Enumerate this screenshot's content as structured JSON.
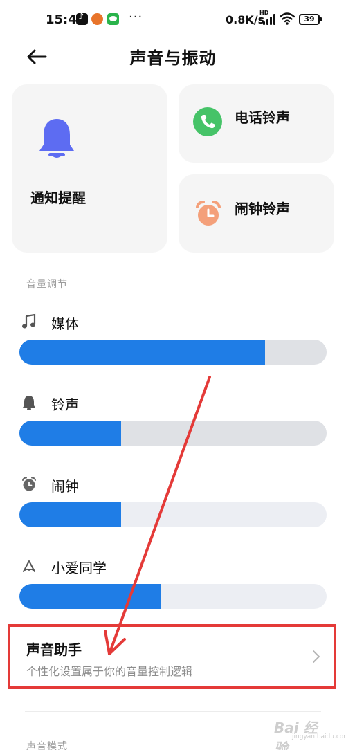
{
  "status_bar": {
    "time": "15:41",
    "dots": "···",
    "network_speed": "0.8K/s",
    "hd_label": "HD",
    "battery": "39"
  },
  "header": {
    "back_icon": "arrow-left-icon",
    "title": "声音与振动"
  },
  "cards": {
    "notify": {
      "label": "通知提醒",
      "icon": "bell-icon",
      "color": "#5d6cf2"
    },
    "phone": {
      "label": "电话铃声",
      "icon": "phone-icon",
      "color": "#46c368"
    },
    "alarm": {
      "label": "闹钟铃声",
      "icon": "alarm-clock-icon",
      "color": "#f4a07a"
    }
  },
  "volume": {
    "section_label": "音量调节",
    "accent_color": "#1f7de6",
    "rows": [
      {
        "label": "媒体",
        "icon": "music-note-icon",
        "level": 0.8
      },
      {
        "label": "铃声",
        "icon": "bell-icon",
        "level": 0.33
      },
      {
        "label": "闹钟",
        "icon": "alarm-clock-icon",
        "level": 0.33
      },
      {
        "label": "小爱同学",
        "icon": "xiaoai-icon",
        "level": 0.46
      }
    ]
  },
  "assistant": {
    "title": "声音助手",
    "description": "个性化设置属于你的音量控制逻辑",
    "highlight_color": "#e43a38"
  },
  "sound_mode": {
    "section_label": "声音模式"
  },
  "watermark": {
    "text": "Bai 经验",
    "sub": "jingyan.baidu.com"
  }
}
